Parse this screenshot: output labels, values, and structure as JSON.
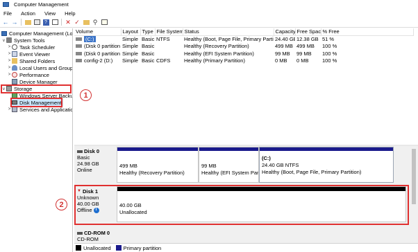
{
  "window": {
    "title": "Computer Management"
  },
  "menu": [
    "File",
    "Action",
    "View",
    "Help"
  ],
  "tree": {
    "root": "Computer Management (Local)",
    "system_tools": "System Tools",
    "task_scheduler": "Task Scheduler",
    "event_viewer": "Event Viewer",
    "shared_folders": "Shared Folders",
    "local_users": "Local Users and Groups",
    "performance": "Performance",
    "device_manager": "Device Manager",
    "storage": "Storage",
    "wsb": "Windows Server Backup",
    "disk_management": "Disk Management",
    "services": "Services and Applications"
  },
  "volume_table": {
    "headers": [
      "Volume",
      "Layout",
      "Type",
      "File System",
      "Status",
      "Capacity",
      "Free Space",
      "% Free"
    ],
    "rows": [
      [
        "(C:)",
        "Simple",
        "Basic",
        "NTFS",
        "Healthy (Boot, Page File, Primary Partition)",
        "24.40 GB",
        "12.38 GB",
        "51 %"
      ],
      [
        "(Disk 0 partition 1)",
        "Simple",
        "Basic",
        "",
        "Healthy (Recovery Partition)",
        "499 MB",
        "499 MB",
        "100 %"
      ],
      [
        "(Disk 0 partition 2)",
        "Simple",
        "Basic",
        "",
        "Healthy (EFI System Partition)",
        "99 MB",
        "99 MB",
        "100 %"
      ],
      [
        "config-2 (D:)",
        "Simple",
        "Basic",
        "CDFS",
        "Healthy (Primary Partition)",
        "0 MB",
        "0 MB",
        "100 %"
      ]
    ]
  },
  "disk0": {
    "name": "Disk 0",
    "type": "Basic",
    "size": "24.98 GB",
    "state": "Online",
    "partitions": [
      {
        "size": "499 MB",
        "status": "Healthy (Recovery Partition)"
      },
      {
        "size": "99 MB",
        "status": "Healthy (EFI System Partitic"
      },
      {
        "label": "(C:)",
        "size": "24.40 GB NTFS",
        "status": "Healthy (Boot, Page File, Primary Partition)"
      }
    ]
  },
  "disk1": {
    "name": "Disk 1",
    "type": "Unknown",
    "size": "40.00 GB",
    "state": "Offline",
    "region_size": "40.00 GB",
    "region_status": "Unallocated"
  },
  "cdrom": {
    "name": "CD-ROM 0",
    "type": "CD-ROM"
  },
  "legend": {
    "unallocated": "Unallocated",
    "primary": "Primary partition"
  },
  "callouts": [
    "1",
    "2"
  ],
  "colors": {
    "primary_partition": "#1a1a8c",
    "unallocated": "#000000",
    "highlight": "#e03030",
    "selection": "#cce8ff"
  },
  "icons": [
    "computer-icon",
    "tools-icon",
    "clock-icon",
    "log-icon",
    "folder-icon",
    "users-icon",
    "gauge-icon",
    "device-icon",
    "storage-icon",
    "backup-icon",
    "disk-icon",
    "services-icon",
    "info-icon"
  ]
}
